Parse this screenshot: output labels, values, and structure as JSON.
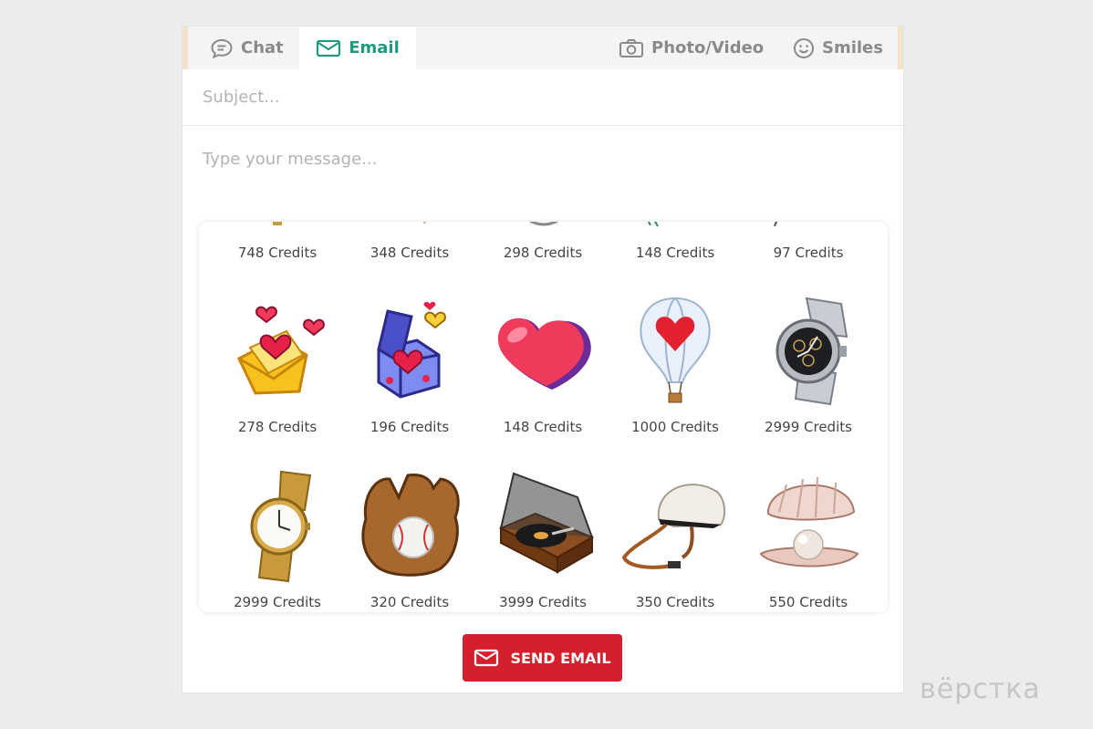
{
  "tabs": {
    "chat": {
      "label": "Chat",
      "icon": "chat-bubble-icon"
    },
    "email": {
      "label": "Email",
      "icon": "envelope-icon",
      "active": true
    },
    "photo": {
      "label": "Photo/Video",
      "icon": "camera-icon"
    },
    "smiles": {
      "label": "Smiles",
      "icon": "smiley-icon"
    }
  },
  "form": {
    "subject_placeholder": "Subject...",
    "message_placeholder": "Type your message..."
  },
  "gifts": {
    "row1": [
      {
        "price": "748 Credits"
      },
      {
        "price": "348 Credits"
      },
      {
        "price": "298 Credits"
      },
      {
        "price": "148 Credits"
      },
      {
        "price": "97 Credits"
      }
    ],
    "row2": [
      {
        "price": "278 Credits",
        "icon": "envelope-hearts-icon"
      },
      {
        "price": "196 Credits",
        "icon": "gift-box-hearts-icon"
      },
      {
        "price": "148 Credits",
        "icon": "heart-icon"
      },
      {
        "price": "1000 Credits",
        "icon": "hot-air-balloon-icon"
      },
      {
        "price": "2999 Credits",
        "icon": "silver-watch-icon"
      }
    ],
    "row3": [
      {
        "price": "2999 Credits",
        "icon": "gold-watch-icon"
      },
      {
        "price": "320 Credits",
        "icon": "baseball-glove-icon"
      },
      {
        "price": "3999 Credits",
        "icon": "record-player-icon"
      },
      {
        "price": "350 Credits",
        "icon": "riding-helmet-icon"
      },
      {
        "price": "550 Credits",
        "icon": "pearl-shell-icon"
      }
    ]
  },
  "send_button": {
    "label": "SEND EMAIL",
    "icon": "envelope-icon"
  },
  "watermark": "вёрстка",
  "colors": {
    "accent_green": "#1f9a82",
    "send_red": "#d51f2d"
  }
}
